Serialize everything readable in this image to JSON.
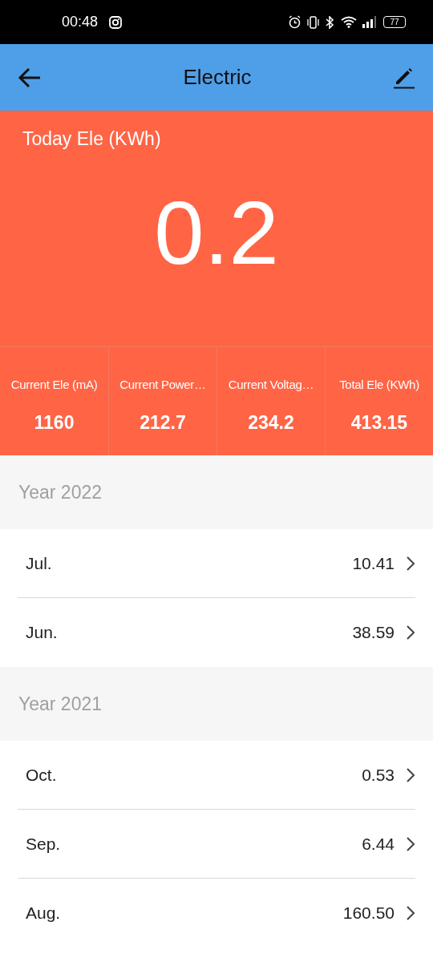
{
  "status_bar": {
    "time": "00:48",
    "battery": "77"
  },
  "header": {
    "title": "Electric"
  },
  "today": {
    "label": "Today Ele (KWh)",
    "value": "0.2"
  },
  "stats": [
    {
      "label": "Current Ele (mA)",
      "value": "1160"
    },
    {
      "label": "Current Power…",
      "value": "212.7"
    },
    {
      "label": "Current Voltag…",
      "value": "234.2"
    },
    {
      "label": "Total Ele (KWh)",
      "value": "413.15"
    }
  ],
  "years": [
    {
      "title": "Year 2022",
      "months": [
        {
          "month": "Jul.",
          "value": "10.41"
        },
        {
          "month": "Jun.",
          "value": "38.59"
        }
      ]
    },
    {
      "title": "Year 2021",
      "months": [
        {
          "month": "Oct.",
          "value": "0.53"
        },
        {
          "month": "Sep.",
          "value": "6.44"
        },
        {
          "month": "Aug.",
          "value": "160.50"
        }
      ]
    }
  ]
}
